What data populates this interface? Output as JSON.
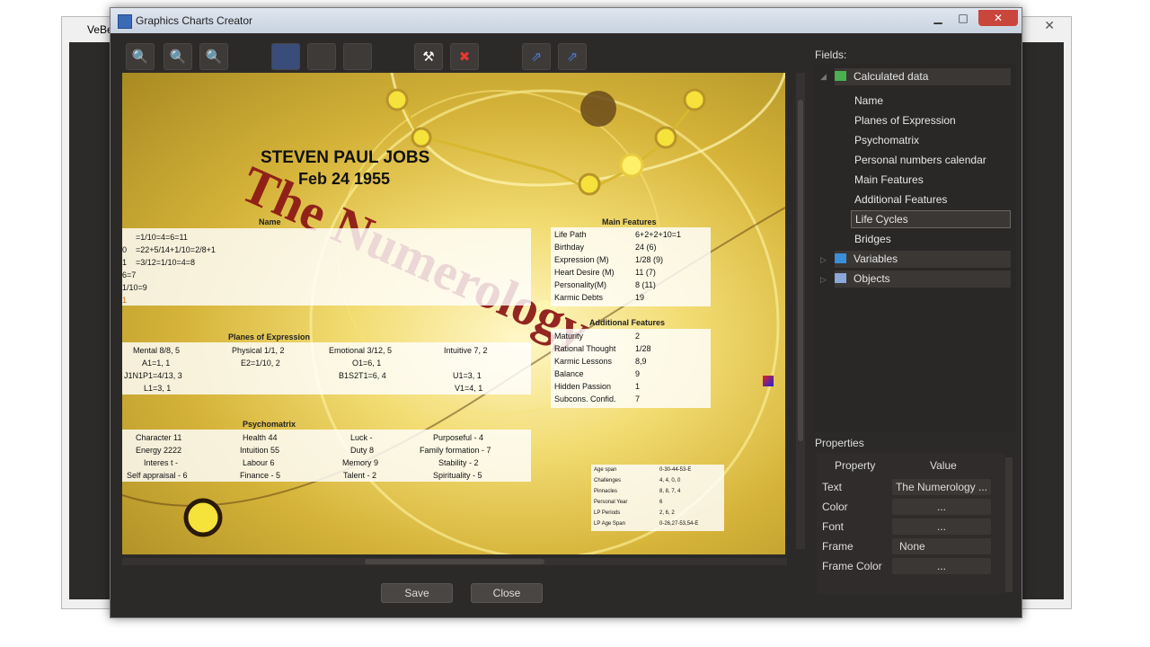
{
  "background_window": {
    "title": "VeBe",
    "close": "✕"
  },
  "window": {
    "title": "Graphics Charts Creator",
    "min": "▁",
    "max": "□",
    "close": "✕"
  },
  "toolbar": {
    "zoom_fit": "🔍",
    "zoom_in": "🔍",
    "zoom_out": "🔍",
    "tool": "⚒",
    "delete": "✖",
    "link1": "⇗",
    "link2": "⇗"
  },
  "chart": {
    "title_art": "The Numerology",
    "person_name": "STEVEN PAUL JOBS",
    "birth_date": "Feb 24 1955",
    "name_panel": {
      "header": "Name",
      "lines": [
        "=1/10=4=6=11",
        "=22+5/14+1/10=2/8+1",
        "=3/12=1/10=4=8",
        "6=7",
        "1/10=9",
        "1"
      ],
      "prefixes": [
        "0",
        "1"
      ]
    },
    "planes_panel": {
      "header": "Planes of Expression",
      "columns": [
        [
          "Mental 8/8, 5",
          "A1=1, 1",
          "J1N1P1=4/13, 3",
          "L1=3, 1"
        ],
        [
          "Physical 1/1, 2",
          "E2=1/10, 2"
        ],
        [
          "Emotional 3/12, 5",
          "O1=6, 1",
          "B1S2T1=6, 4"
        ],
        [
          "Intuitive 7, 2",
          "U1=3, 1",
          "V1=4, 1"
        ]
      ]
    },
    "psycho_panel": {
      "header": "Psychomatrix",
      "rows": [
        [
          "Character 11",
          "Health 44",
          "Luck -",
          "Purposeful - 4"
        ],
        [
          "Energy 2222",
          "Intuition 55",
          "Duty 8",
          "Family formation - 7"
        ],
        [
          "Interes t -",
          "Labour 6",
          "Memory 9",
          "Stability - 2"
        ],
        [
          "Self appraisal - 6",
          "Finance - 5",
          "Talent - 2",
          "Spirituality - 5"
        ]
      ]
    },
    "main_features": {
      "header": "Main Features",
      "rows": [
        [
          "Life Path",
          "6+2+2+10=1"
        ],
        [
          "Birthday",
          "24 (6)"
        ],
        [
          "Expression (M)",
          "1/28 (9)"
        ],
        [
          "Heart Desire (M)",
          "11 (7)"
        ],
        [
          "Personality(M)",
          "8 (11)"
        ],
        [
          "Karmic Debts",
          "19"
        ]
      ]
    },
    "additional_features": {
      "header": "Additional Features",
      "rows": [
        [
          "Maturity",
          "2"
        ],
        [
          "Rational Thought",
          "1/28"
        ],
        [
          "Karmic Lessons",
          "8,9"
        ],
        [
          "Balance",
          "9"
        ],
        [
          "Hidden Passion",
          "1"
        ],
        [
          "Subcons. Confid.",
          "7"
        ]
      ]
    },
    "life_cycles": {
      "rows": [
        [
          "Age span",
          "0-30-44-53-E"
        ],
        [
          "Challenges",
          "4, 4, 0, 0"
        ],
        [
          "Pinnacles",
          "8, 8, 7, 4"
        ],
        [
          "Personal Year",
          "6"
        ],
        [
          "LP Periods",
          "2, 6, 2"
        ],
        [
          "LP Age Span",
          "0-26,27-53,54-E"
        ]
      ]
    }
  },
  "buttons": {
    "save": "Save",
    "close": "Close"
  },
  "fields": {
    "label": "Fields:",
    "calculated": "Calculated data",
    "items": [
      "Name",
      "Planes of Expression",
      "Psychomatrix",
      "Personal numbers calendar",
      "Main Features",
      "Additional Features",
      "Life Cycles",
      "Bridges"
    ],
    "selected_index": 6,
    "variables": "Variables",
    "objects": "Objects"
  },
  "properties": {
    "label": "Properties",
    "col_property": "Property",
    "col_value": "Value",
    "rows": [
      {
        "name": "Text",
        "value": "The Numerology ..."
      },
      {
        "name": "Color",
        "value": "..."
      },
      {
        "name": "Font",
        "value": "..."
      },
      {
        "name": "Frame",
        "value": "None"
      },
      {
        "name": "Frame Color",
        "value": "..."
      }
    ]
  },
  "colors": {
    "accent_red": "#8b1515",
    "selection": "#4a4644",
    "panel_bg": "#2c2a29"
  }
}
